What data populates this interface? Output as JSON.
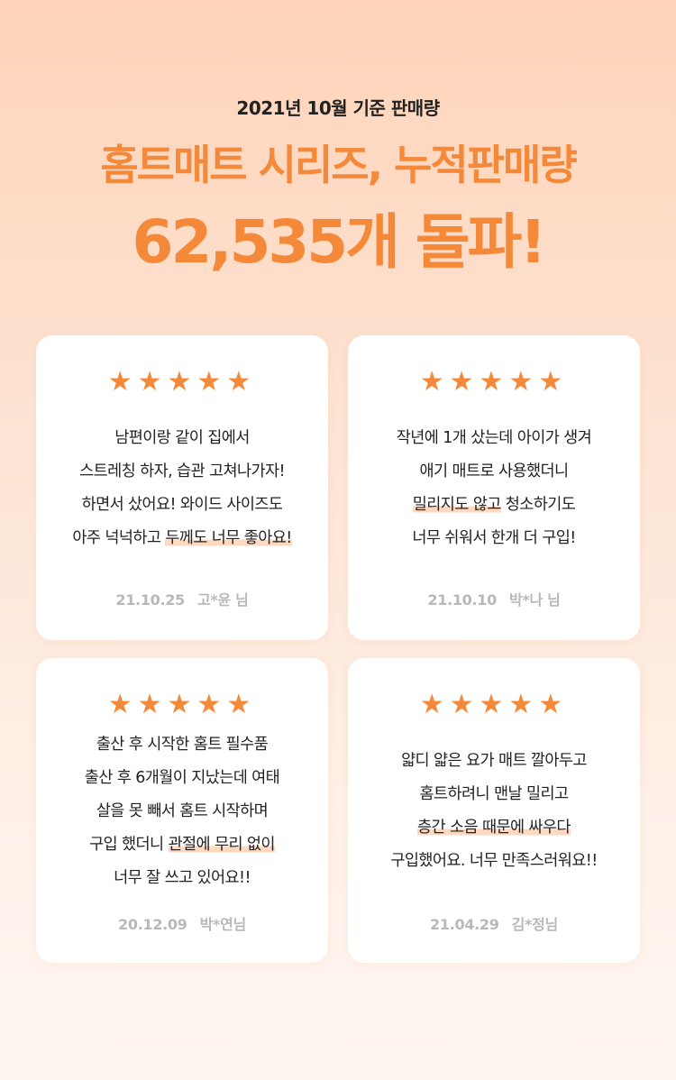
{
  "header": {
    "subtitle": "2021년 10월 기준 판매량",
    "headline_line1": "홈트매트 시리즈, 누적판매량",
    "headline_line2": "62,535개 돌파!"
  },
  "colors": {
    "accent": "#f5893a",
    "highlight": "#ffd8c0"
  },
  "rating_icon": "star-icon",
  "reviews": [
    {
      "stars": "★★★★★",
      "line1": "남편이랑 같이 집에서",
      "line2": "스트레칭 하자, 습관 고쳐나가자!",
      "line3": "하면서 샀어요! 와이드 사이즈도",
      "line4_pre": "아주 넉넉하고 ",
      "line4_hl": "두께도 너무 좋아요!",
      "date": "21.10.25",
      "author": "고*윤 님"
    },
    {
      "stars": "★★★★★",
      "line1": "작년에 1개 샀는데 아이가 생겨",
      "line2": "애기 매트로 사용했더니",
      "line3_hl": "밀리지도 않고",
      "line3_post": " 청소하기도",
      "line4": "너무 쉬워서 한개 더 구입!",
      "date": "21.10.10",
      "author": "박*나 님"
    },
    {
      "stars": "★★★★★",
      "line1": "출산 후 시작한 홈트 필수품",
      "line2": "출산 후 6개월이 지났는데 여태",
      "line3": "살을 못 빼서 홈트 시작하며",
      "line4_pre": "구입 했더니 ",
      "line4_hl": "관절에 무리 없이",
      "line5": "너무 잘 쓰고 있어요!!",
      "date": "20.12.09",
      "author": "박*연님"
    },
    {
      "stars": "★★★★★",
      "line1": "얇디 얇은 요가 매트 깔아두고",
      "line2": "홈트하려니 맨날 밀리고",
      "line3_hl": "층간 소음 때문에 싸우다",
      "line4": "구입했어요. 너무 만족스러워요!!",
      "date": "21.04.29",
      "author": "김*정님"
    }
  ]
}
